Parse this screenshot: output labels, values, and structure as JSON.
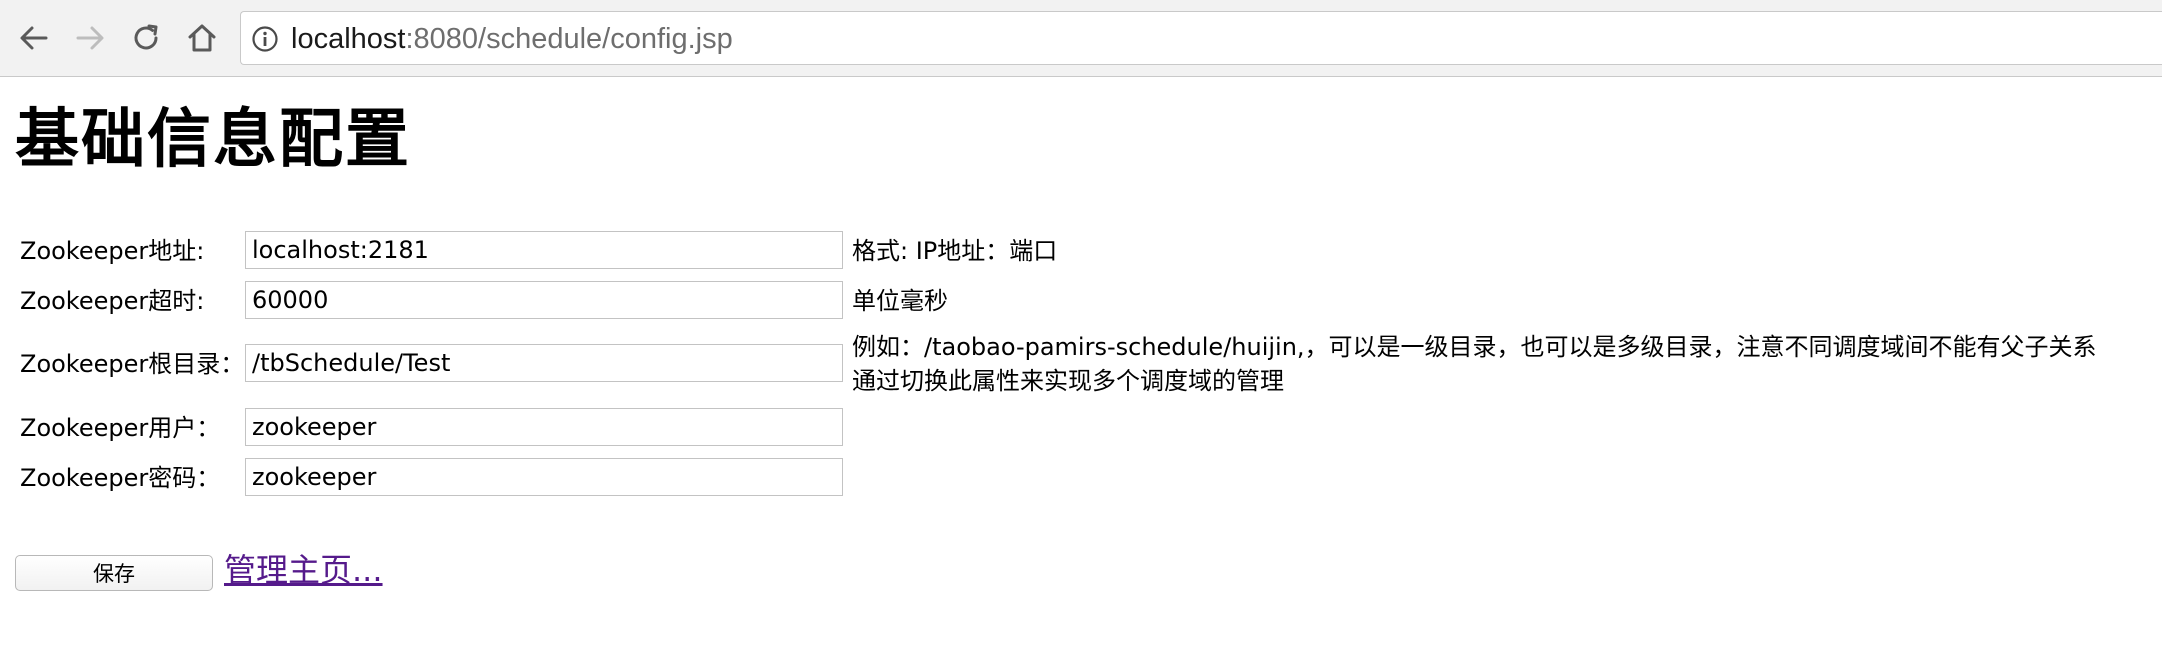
{
  "browser": {
    "url_host": "localhost",
    "url_rest": ":8080/schedule/config.jsp",
    "icons": [
      "back-arrow-icon",
      "forward-arrow-icon",
      "reload-icon",
      "home-icon",
      "info-icon"
    ]
  },
  "page": {
    "title": "基础信息配置"
  },
  "form": {
    "rows": [
      {
        "label": "Zookeeper地址:",
        "value": "localhost:2181",
        "hint": "格式: IP地址：端口"
      },
      {
        "label": "Zookeeper超时:",
        "value": "60000",
        "hint": "单位毫秒"
      },
      {
        "label": "Zookeeper根目录：",
        "value": "/tbSchedule/Test",
        "hint_line1": "例如：/taobao-pamirs-schedule/huijin,，可以是一级目录，也可以是多级目录，注意不同调度域间不能有父子关系",
        "hint_line2": "通过切换此属性来实现多个调度域的管理"
      },
      {
        "label": "Zookeeper用户：",
        "value": "zookeeper"
      },
      {
        "label": "Zookeeper密码：",
        "value": "zookeeper"
      }
    ],
    "save_label": "保存",
    "home_link": "管理主页..."
  },
  "colors": {
    "toolbar_bg": "#f2f2f2",
    "visited_link": "#551a8b",
    "url_host": "#1a1a1a",
    "url_rest": "#6e6e6e"
  }
}
